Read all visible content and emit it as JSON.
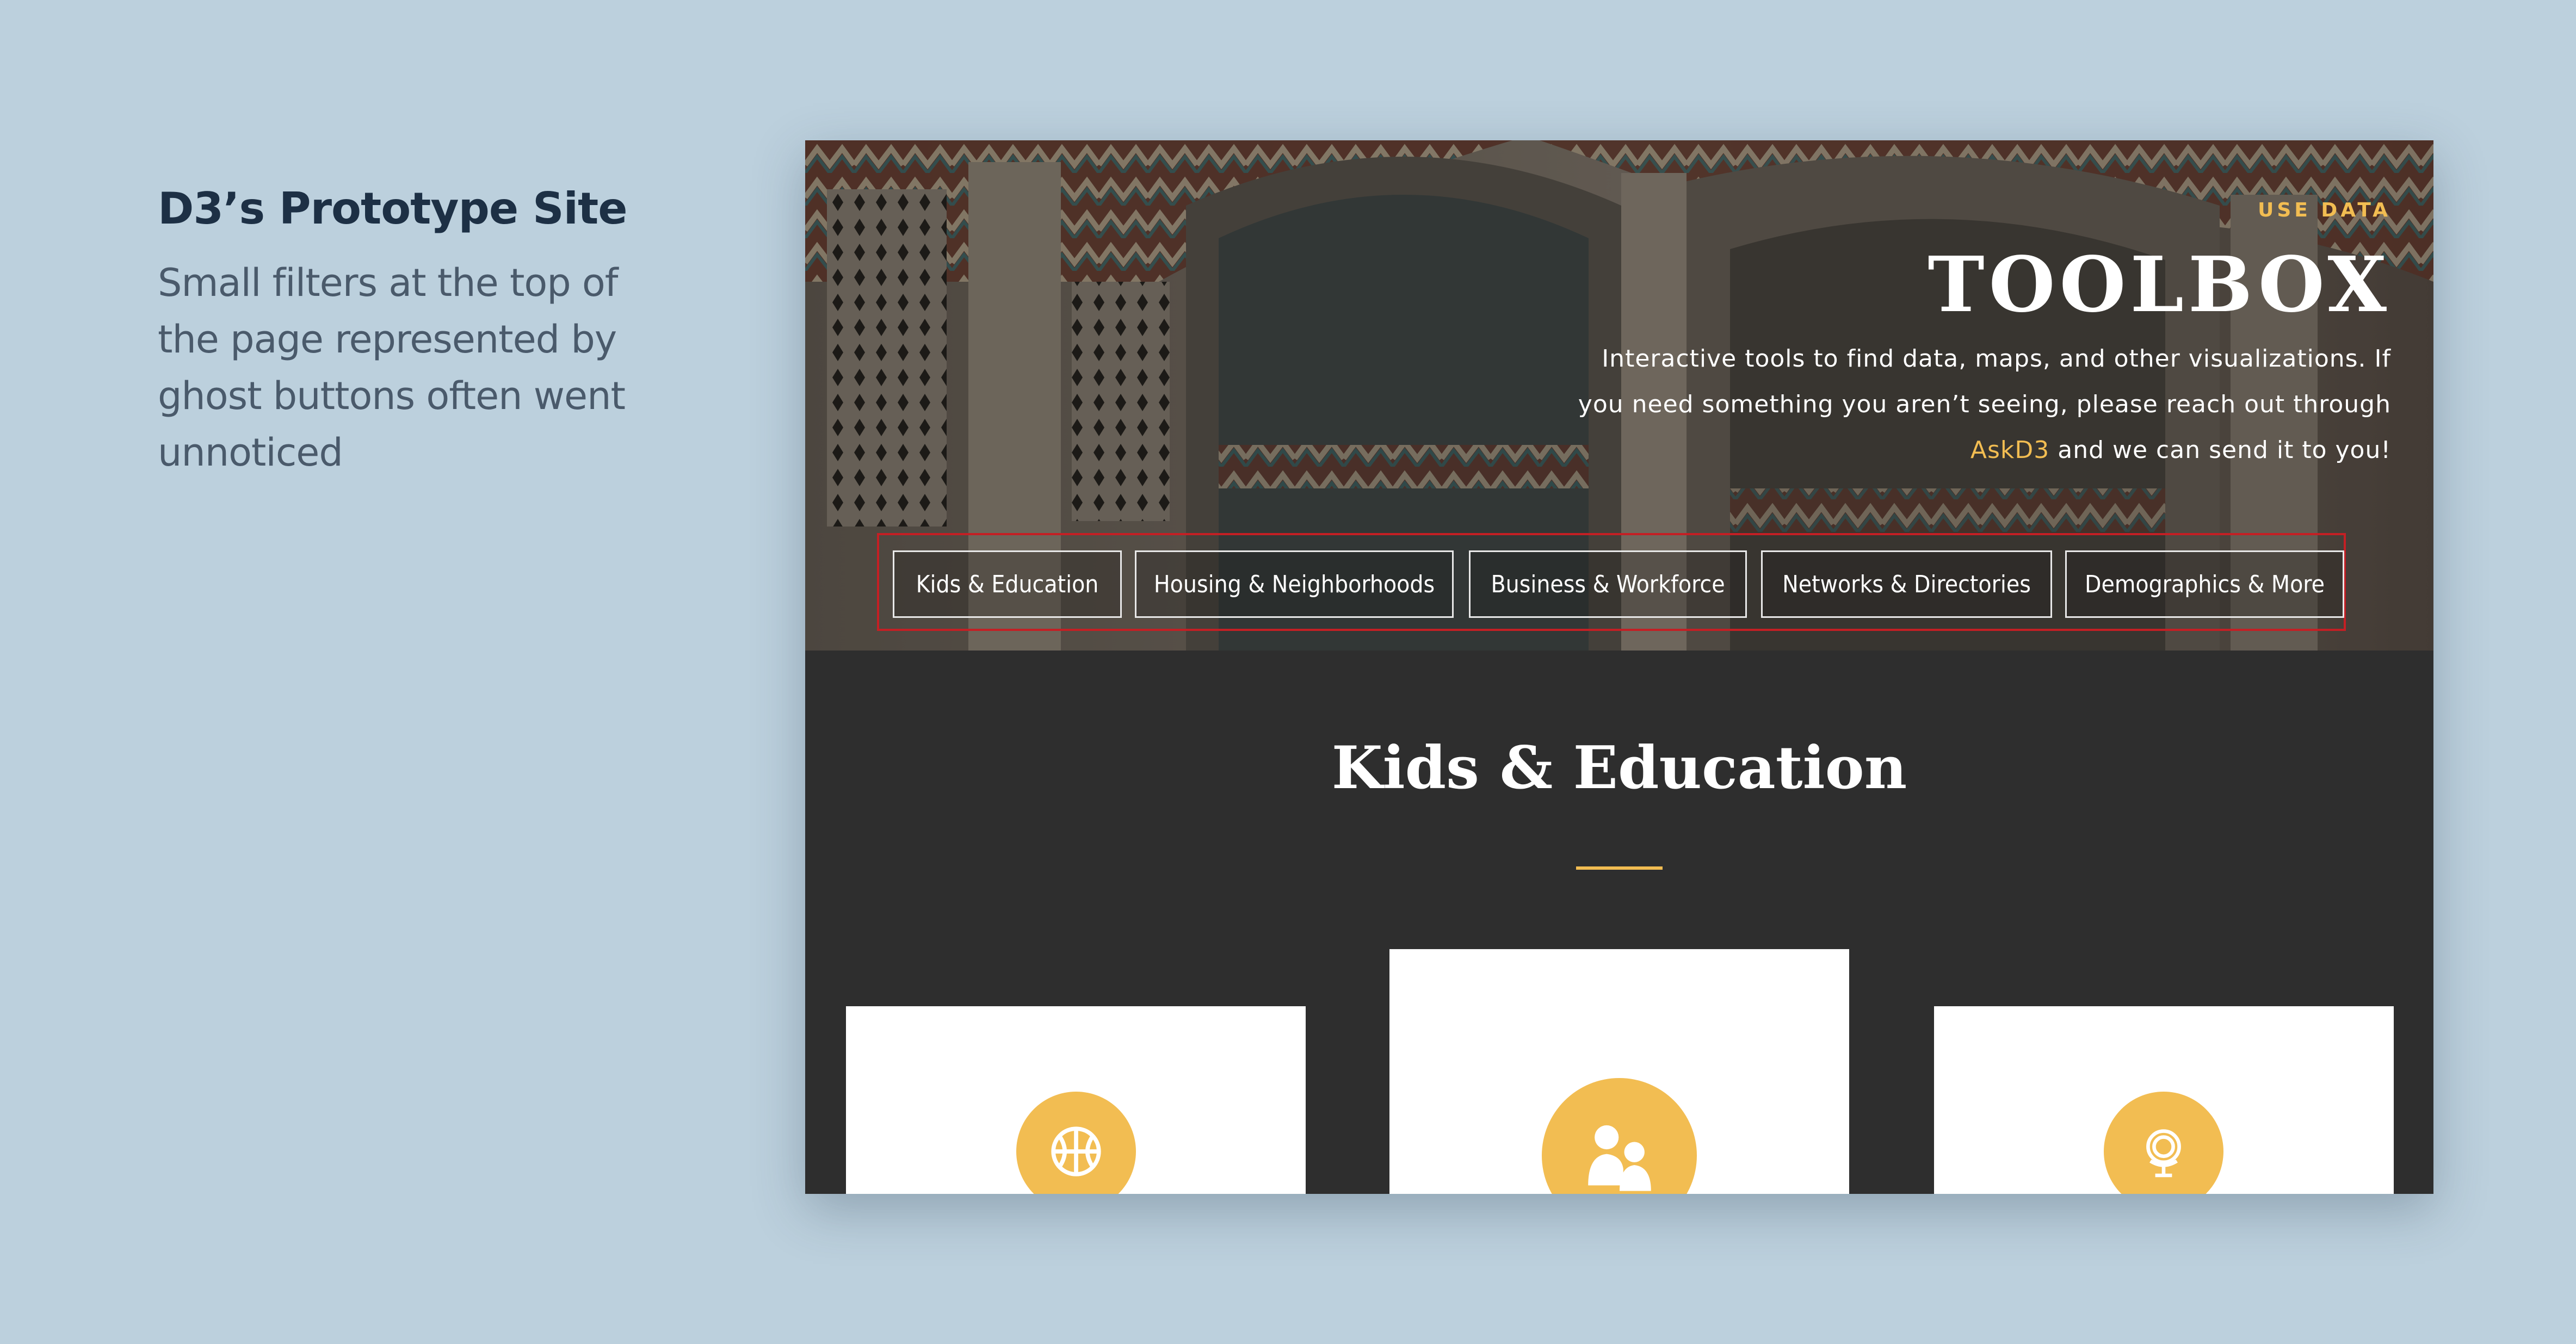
{
  "caption": {
    "title": "D3’s Prototype Site",
    "body": "Small filters at the top of the page represented by ghost buttons often went unnoticed"
  },
  "hero": {
    "eyebrow": "USE DATA",
    "title": "TOOLBOX",
    "description_1": "Interactive tools to find data, maps, and other visualizations.  If you need something you aren’t seeing, please reach out through ",
    "link": "AskD3",
    "description_2": " and we can send it to you!"
  },
  "filters": [
    "Kids & Education",
    "Housing & Neighborhoods",
    "Business & Workforce",
    "Networks & Directories",
    "Demographics & More"
  ],
  "section": {
    "title": "Kids & Education"
  },
  "cards": [
    {
      "icon": "basketball-icon"
    },
    {
      "icon": "family-icon"
    },
    {
      "icon": "globe-icon"
    }
  ],
  "colors": {
    "background": "#bcd0dd",
    "accent": "#f2bd52",
    "highlight_frame": "#c41f24",
    "section_background": "#2e2e2e",
    "caption_title": "#1d3045"
  }
}
